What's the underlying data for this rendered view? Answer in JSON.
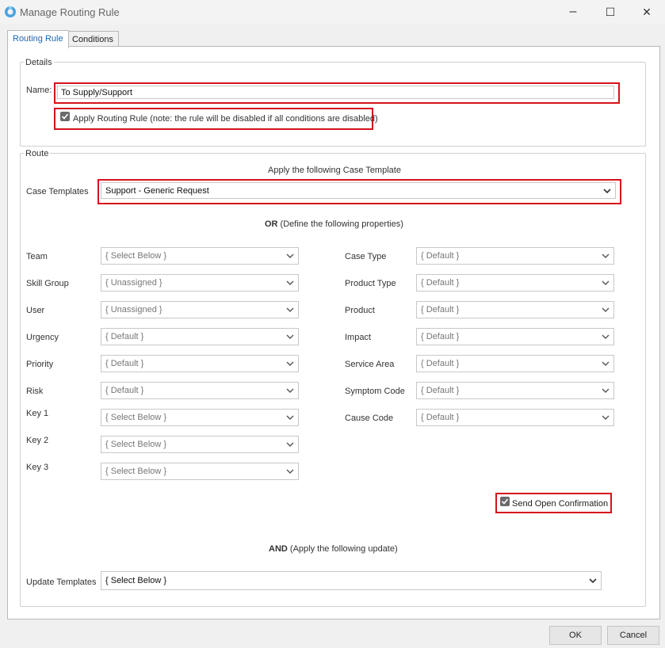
{
  "window": {
    "title": "Manage Routing Rule",
    "controls": [
      "–",
      "☐",
      "✕"
    ]
  },
  "tabs": [
    {
      "label": "Routing Rule",
      "active": true
    },
    {
      "label": "Conditions",
      "active": false
    }
  ],
  "details": {
    "legend": "Details",
    "name_label": "Name:",
    "name_value": "To Supply/Support",
    "apply_checkbox_label": "Apply Routing Rule (note: the rule will be disabled if all conditions are disabled)",
    "apply_checked": true
  },
  "route": {
    "legend": "Route",
    "apply_heading": "Apply the following Case Template",
    "case_templates_label": "Case Templates",
    "case_templates_value": "Support - Generic Request",
    "or_bold": "OR",
    "or_rest": " (Define the following properties)",
    "left_fields": [
      {
        "label": "Team",
        "value": "{ Select Below }"
      },
      {
        "label": "Skill Group",
        "value": "{ Unassigned }"
      },
      {
        "label": "User",
        "value": "{ Unassigned }"
      },
      {
        "label": "Urgency",
        "value": "{ Default }"
      },
      {
        "label": "Priority",
        "value": "{ Default }"
      },
      {
        "label": "Risk",
        "value": "{ Default }"
      },
      {
        "label": "Key 1",
        "value": "{ Select Below }"
      },
      {
        "label": "Key 2",
        "value": "{ Select Below }"
      },
      {
        "label": "Key 3",
        "value": "{ Select Below }"
      }
    ],
    "right_fields": [
      {
        "label": "Case Type",
        "value": "{ Default }"
      },
      {
        "label": "Product Type",
        "value": "{ Default }"
      },
      {
        "label": "Product",
        "value": "{ Default }"
      },
      {
        "label": "Impact",
        "value": "{ Default }"
      },
      {
        "label": "Service Area",
        "value": "{ Default }"
      },
      {
        "label": "Symptom Code",
        "value": "{ Default }"
      },
      {
        "label": "Cause Code",
        "value": "{ Default }"
      }
    ],
    "send_confirmation_label": "Send Open Confirmation",
    "send_confirmation_checked": true,
    "and_bold": "AND",
    "and_rest": " (Apply the following update)",
    "update_templates_label": "Update Templates",
    "update_templates_value": "{ Select Below }"
  },
  "footer": {
    "ok_label": "OK",
    "cancel_label": "Cancel"
  },
  "colors": {
    "highlight": "#d4131b",
    "tab_active_text": "#1c67b5",
    "app_icon": "#4aa3df"
  }
}
